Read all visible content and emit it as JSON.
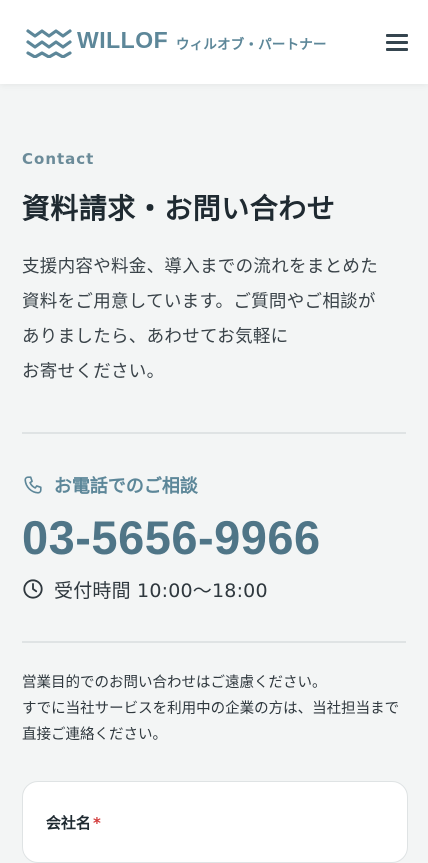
{
  "header": {
    "logo_text": "WILLOF",
    "logo_sub": "ウィルオブ・パートナー",
    "menu_icon": "hamburger-icon",
    "brand_color": "#5d8799"
  },
  "contact": {
    "eyebrow": "Contact",
    "title": "資料請求・お問い合わせ",
    "intro_lines": [
      "支援内容や料金、導入までの流れをまとめた",
      "資料をご用意しています。ご質問やご相談が",
      "ありましたら、あわせてお気軽に",
      "お寄せください。"
    ]
  },
  "phone": {
    "icon": "phone-icon",
    "label": "お電話でのご相談",
    "number": "03-5656-9966",
    "hours_icon": "clock-icon",
    "hours": "受付時間 10:00〜18:00"
  },
  "notice": {
    "lines": [
      "営業目的でのお問い合わせはご遠慮ください。",
      "すでに当社サービスを利用中の企業の方は、当社担当まで",
      "直接ご連絡ください。"
    ]
  },
  "form": {
    "company_label": "会社名",
    "required_mark": "*"
  }
}
